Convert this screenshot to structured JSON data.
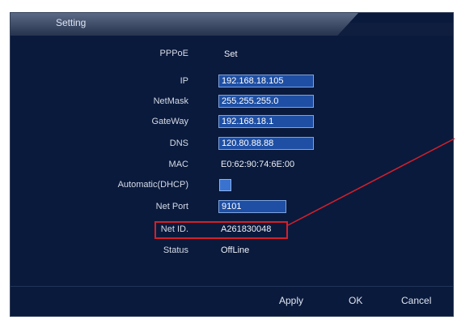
{
  "window": {
    "title": "Setting"
  },
  "form": {
    "pppoe": {
      "label": "PPPoE",
      "value": "Set"
    },
    "ip": {
      "label": "IP",
      "value": "192.168.18.105"
    },
    "netmask": {
      "label": "NetMask",
      "value": "255.255.255.0"
    },
    "gateway": {
      "label": "GateWay",
      "value": "192.168.18.1"
    },
    "dns": {
      "label": "DNS",
      "value": "120.80.88.88"
    },
    "mac": {
      "label": "MAC",
      "value": "E0:62:90:74:6E:00"
    },
    "dhcp": {
      "label": "Automatic(DHCP)",
      "checked": true
    },
    "net_port": {
      "label": "Net Port",
      "value": "9101"
    },
    "net_id": {
      "label": "Net ID.",
      "value": "A261830048"
    },
    "status": {
      "label": "Status",
      "value": "OffLine"
    }
  },
  "buttons": {
    "apply": "Apply",
    "ok": "OK",
    "cancel": "Cancel"
  },
  "colors": {
    "panel_bg": "#0a1a3c",
    "field_bg": "#1e4fa4",
    "field_border": "#7ea3df",
    "highlight": "#d71f2a",
    "text": "#d6dbe8"
  }
}
